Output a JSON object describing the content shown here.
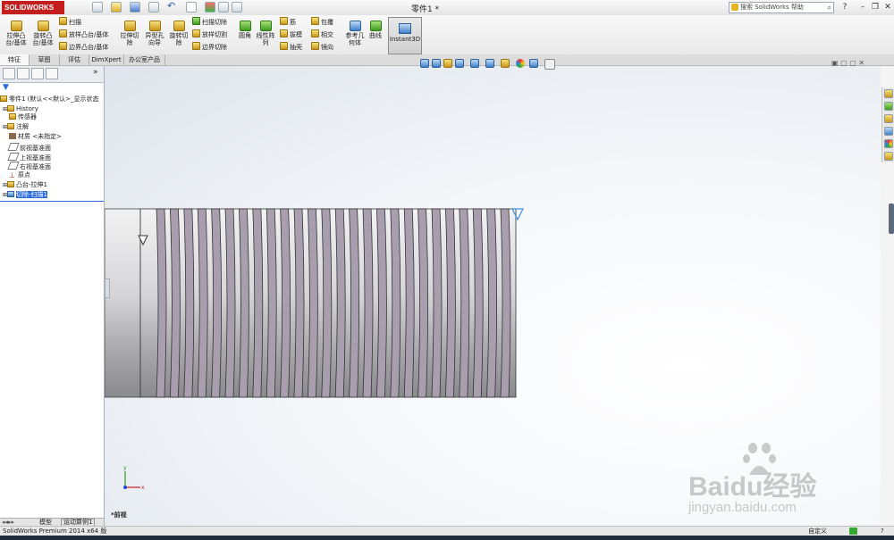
{
  "app": {
    "logo_text": "SOLIDWORKS",
    "document_title": "零件1 *",
    "search_placeholder": "搜索 SolidWorks 帮助"
  },
  "ribbon": {
    "big_buttons": [
      {
        "label": "拉伸凸台/基体"
      },
      {
        "label": "旋转凸台/基体"
      }
    ],
    "boss_small": [
      "扫描",
      "放样凸台/基体",
      "边界凸台/基体"
    ],
    "cut_buttons": [
      {
        "label": "拉伸切除"
      },
      {
        "label": "异型孔向导"
      },
      {
        "label": "旋转切除"
      }
    ],
    "cut_small": [
      "扫描切除",
      "放样切割",
      "边界切除"
    ],
    "feature_buttons": [
      {
        "label": "圆角"
      },
      {
        "label": "线性阵列"
      }
    ],
    "feature_small_a": [
      "筋",
      "拔模",
      "抽壳"
    ],
    "feature_small_b": [
      "包覆",
      "相交",
      "镜向"
    ],
    "ref_buttons": [
      {
        "label": "参考几何体"
      },
      {
        "label": "曲线"
      }
    ],
    "instant3d": "Instant3D"
  },
  "tabs": [
    {
      "label": "特征",
      "active": true
    },
    {
      "label": "草图",
      "active": false
    },
    {
      "label": "评估",
      "active": false
    },
    {
      "label": "DimXpert",
      "active": false
    },
    {
      "label": "办公室产品",
      "active": false
    }
  ],
  "tree": [
    {
      "label": "零件1  (默认<<默认>_显示状态",
      "icon": "part-icon",
      "selected": false
    },
    {
      "label": "History",
      "icon": "history-icon",
      "selected": false
    },
    {
      "label": "传感器",
      "icon": "sensor-icon",
      "selected": false
    },
    {
      "label": "注解",
      "icon": "annotation-icon",
      "selected": false
    },
    {
      "label": "材质 <未指定>",
      "icon": "material-icon",
      "selected": false
    },
    {
      "label": "前视基准面",
      "icon": "plane-icon",
      "selected": false
    },
    {
      "label": "上视基准面",
      "icon": "plane-icon",
      "selected": false
    },
    {
      "label": "右视基准面",
      "icon": "plane-icon",
      "selected": false
    },
    {
      "label": "原点",
      "icon": "origin-icon",
      "selected": false
    },
    {
      "label": "凸台-拉伸1",
      "icon": "extrude-icon",
      "selected": false
    },
    {
      "label": "切除-扫描1",
      "icon": "sweep-cut-icon",
      "selected": true
    }
  ],
  "panel_bottom_tabs": [
    "模型",
    "运动算例1"
  ],
  "view": {
    "name": "*前视",
    "axis_x": "x",
    "axis_y": "y"
  },
  "status": {
    "left": "SolidWorks Premium 2014 x64 版",
    "units": "自定义"
  },
  "watermark": {
    "brand": "Baidu经验",
    "url": "jingyan.baidu.com"
  },
  "colors": {
    "accent": "#2a6bd9",
    "thread_metal": "#a89eae",
    "shaft_metal": "#c9c9cc",
    "logo_red": "#c41e1e"
  }
}
